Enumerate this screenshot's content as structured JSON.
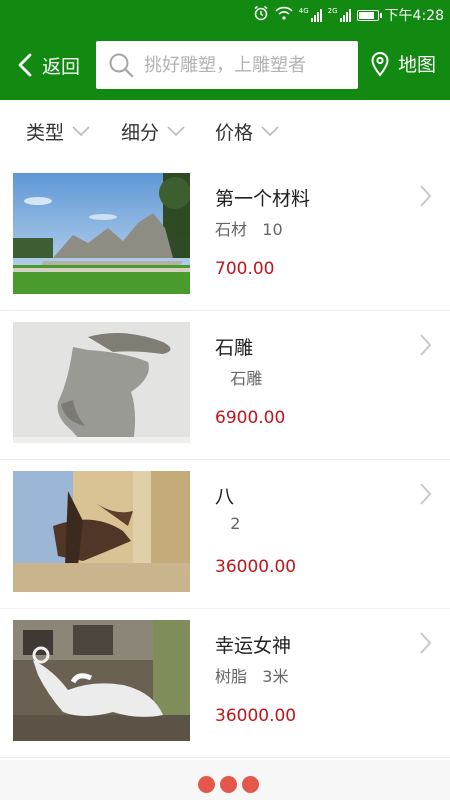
{
  "status_bar": {
    "time": "下午4:28",
    "alarm_icon": "alarm-icon",
    "wifi_icon": "wifi-icon",
    "net1": "4G",
    "net2": "2G",
    "battery_level": 0.9
  },
  "header": {
    "back_label": "返回",
    "search_placeholder": "挑好雕塑，上雕塑者",
    "map_label": "地图",
    "bg_color": "#128a12"
  },
  "filters": [
    {
      "label": "类型"
    },
    {
      "label": "细分"
    },
    {
      "label": "价格"
    }
  ],
  "items": [
    {
      "title": "第一个材料",
      "sub": "石材   10",
      "price": "700.00"
    },
    {
      "title": "石雕",
      "sub": "   石雕",
      "price": "6900.00"
    },
    {
      "title": "八",
      "sub": "   2",
      "price": "36000.00"
    },
    {
      "title": "幸运女神",
      "sub": "树脂   3米",
      "price": "36000.00"
    }
  ],
  "colors": {
    "accent": "#128a12",
    "price": "#c0151b",
    "loading_dot": "#e4574a"
  }
}
